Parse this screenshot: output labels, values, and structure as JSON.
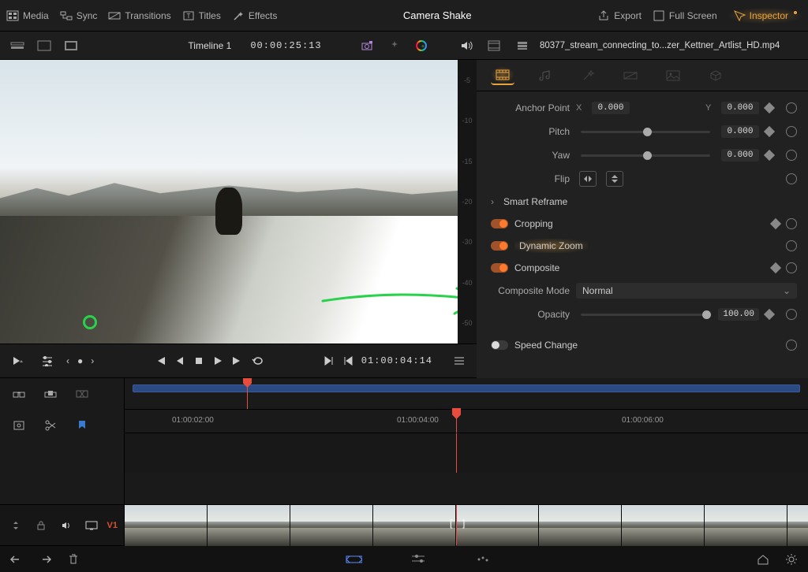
{
  "topbar": {
    "media": "Media",
    "sync": "Sync",
    "transitions": "Transitions",
    "titles": "Titles",
    "effects": "Effects",
    "center": "Camera Shake",
    "export": "Export",
    "fullscreen": "Full Screen",
    "inspector": "Inspector"
  },
  "subbar": {
    "timeline": "Timeline 1",
    "tc": "00:00:25:13",
    "clipname": "80377_stream_connecting_to...zer_Kettner_Artlist_HD.mp4"
  },
  "inspector": {
    "anchor": {
      "label": "Anchor Point",
      "x_axis": "X",
      "x": "0.000",
      "y_axis": "Y",
      "y": "0.000"
    },
    "pitch": {
      "label": "Pitch",
      "val": "0.000"
    },
    "yaw": {
      "label": "Yaw",
      "val": "0.000"
    },
    "flip": {
      "label": "Flip"
    },
    "smart_reframe": "Smart Reframe",
    "cropping": "Cropping",
    "dynamic_zoom": "Dynamic Zoom",
    "composite": "Composite",
    "composite_mode_label": "Composite Mode",
    "composite_mode_value": "Normal",
    "opacity_label": "Opacity",
    "opacity_value": "100.00",
    "speed_change": "Speed Change"
  },
  "transport": {
    "tc": "01:00:04:14"
  },
  "timeline": {
    "ticks": [
      "01:00:02:00",
      "01:00:04:00",
      "01:00:06:00"
    ],
    "track_label": "V1"
  },
  "ruler": {
    "marks": [
      "-5",
      "-10",
      "-15",
      "-20",
      "-30",
      "-40",
      "-50"
    ]
  }
}
